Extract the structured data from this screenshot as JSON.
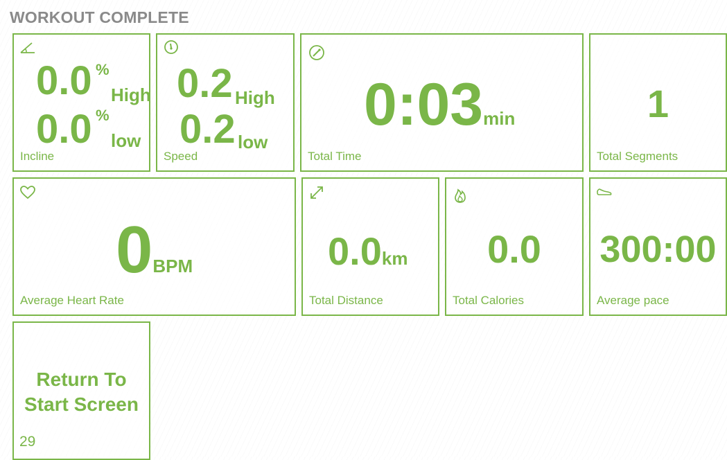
{
  "header": {
    "title": "WORKOUT COMPLETE"
  },
  "accent_color": "#7ab648",
  "tiles": {
    "incline": {
      "high": "0.0",
      "low": "0.0",
      "unit": "%",
      "high_label": "High",
      "low_label": "low",
      "label": "Incline",
      "icon": "incline-icon"
    },
    "speed": {
      "high": "0.2",
      "low": "0.2",
      "high_label": "High",
      "low_label": "low",
      "label": "Speed",
      "icon": "speedometer-icon"
    },
    "total_time": {
      "value": "0:03",
      "unit": "min",
      "label": "Total Time",
      "icon": "gauge-icon"
    },
    "total_segments": {
      "value": "1",
      "label": "Total Segments"
    },
    "heart_rate": {
      "value": "0",
      "unit": "BPM",
      "label": "Average Heart Rate",
      "icon": "heart-icon"
    },
    "distance": {
      "value": "0.0",
      "unit": "km",
      "label": "Total Distance",
      "icon": "expand-arrows-icon"
    },
    "calories": {
      "value": "0.0",
      "label": "Total Calories",
      "icon": "flame-icon"
    },
    "pace": {
      "value": "300:00",
      "label": "Average pace",
      "icon": "shoe-icon"
    }
  },
  "return_button": {
    "label_line1": "Return To",
    "label_line2": "Start Screen",
    "countdown": "29"
  }
}
